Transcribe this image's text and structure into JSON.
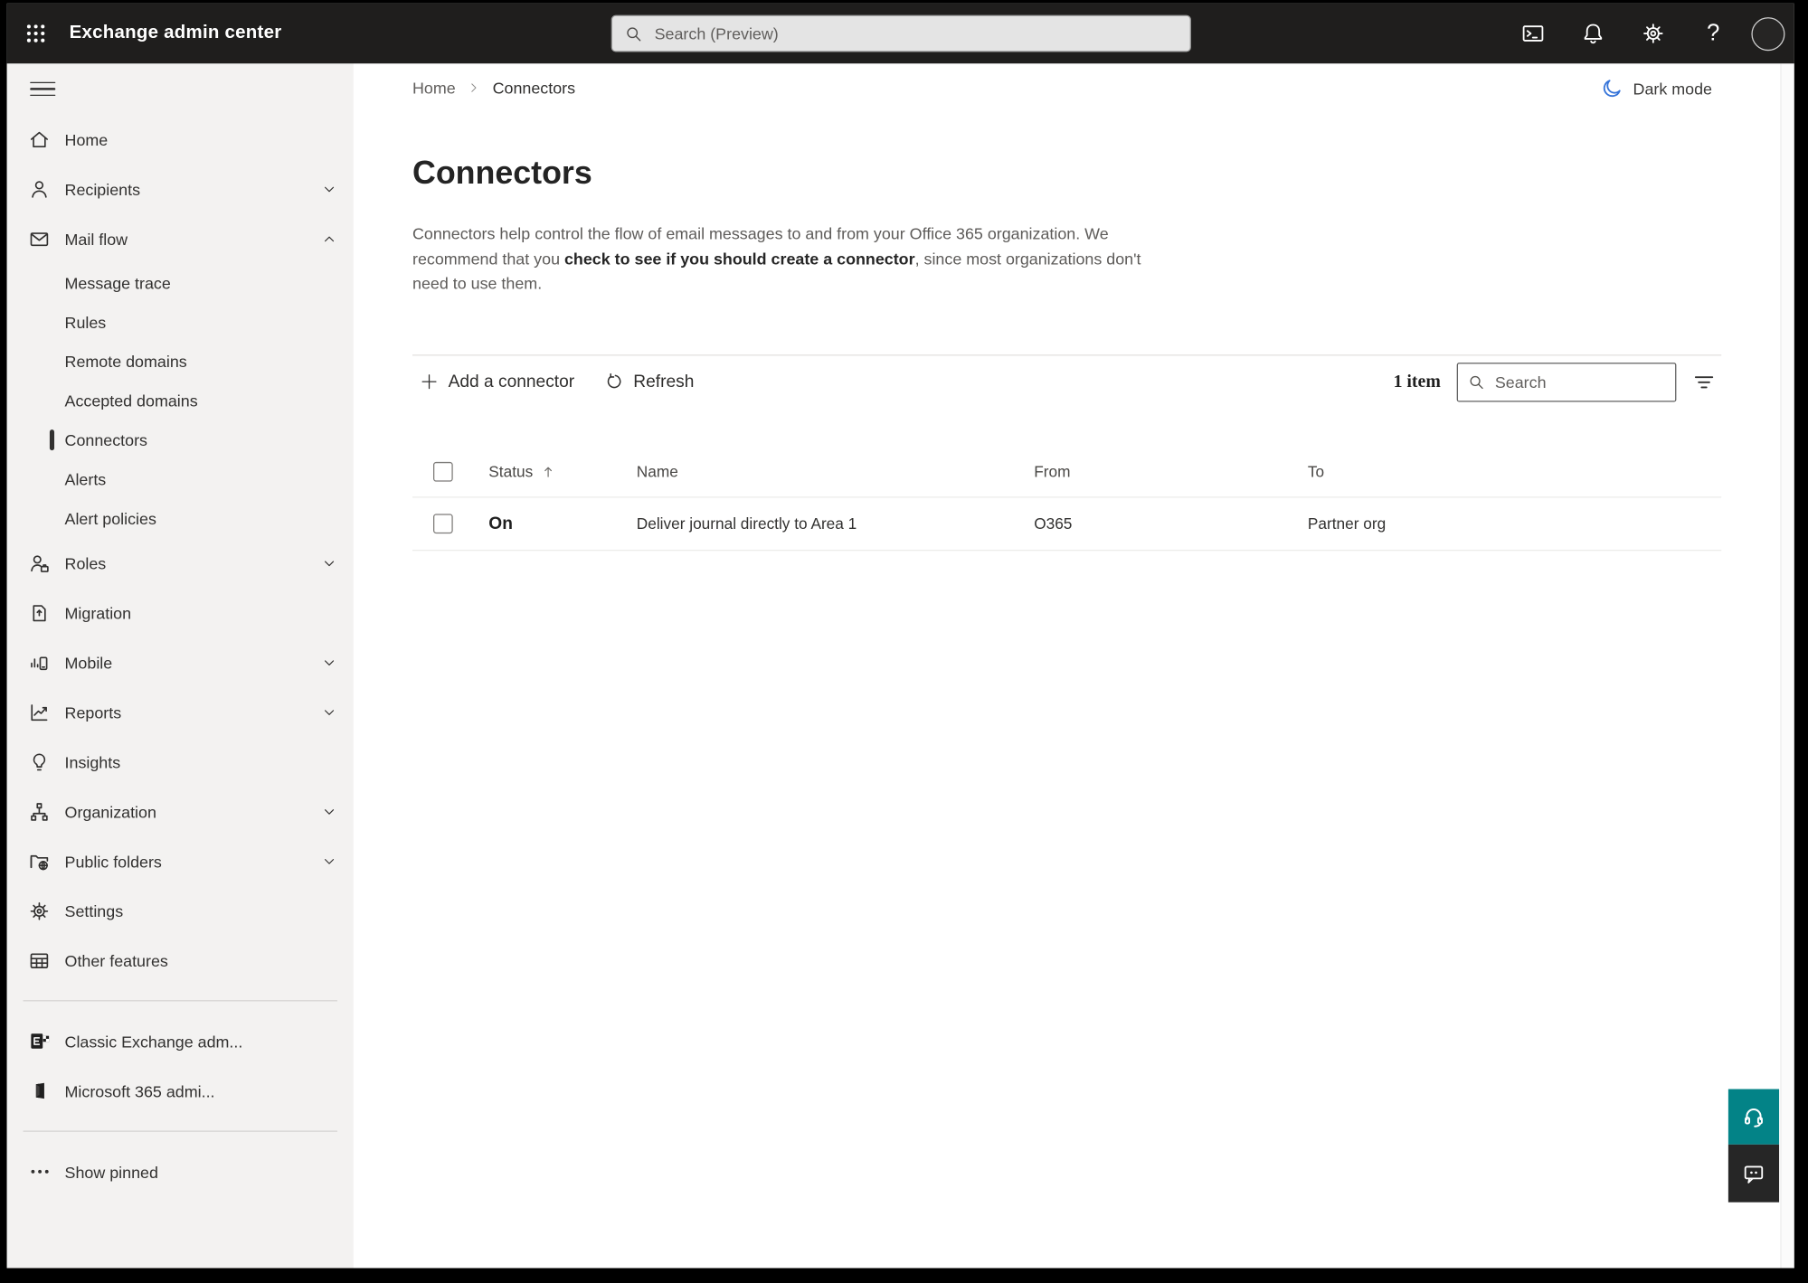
{
  "topbar": {
    "app_title": "Exchange admin center",
    "search_placeholder": "Search (Preview)",
    "icons": [
      "app-launcher",
      "cloud-shell",
      "notifications",
      "settings",
      "help",
      "account"
    ],
    "help_glyph": "?"
  },
  "breadcrumb": {
    "home": "Home",
    "current": "Connectors"
  },
  "dark_mode_label": "Dark mode",
  "page": {
    "title": "Connectors",
    "description_part1": "Connectors help control the flow of email messages to and from your Office 365 organization. We recommend that you ",
    "description_link": "check to see if you should create a connector",
    "description_part2": ", since most organizations don't need to use them."
  },
  "toolbar": {
    "add_label": "Add a connector",
    "refresh_label": "Refresh",
    "item_count": "1 item",
    "search_placeholder": "Search"
  },
  "table": {
    "headers": {
      "status": "Status",
      "name": "Name",
      "from": "From",
      "to": "To"
    },
    "sorted_by": "Status ascending",
    "rows": [
      {
        "status": "On",
        "name": "Deliver journal directly to Area 1",
        "from": "O365",
        "to": "Partner org"
      }
    ]
  },
  "sidebar": {
    "items": [
      {
        "label": "Home",
        "icon": "home-icon"
      },
      {
        "label": "Recipients",
        "icon": "person-icon",
        "chevron": "down"
      },
      {
        "label": "Mail flow",
        "icon": "mail-icon",
        "chevron": "up",
        "expanded": true
      },
      {
        "label": "Message trace",
        "sub": true
      },
      {
        "label": "Rules",
        "sub": true
      },
      {
        "label": "Remote domains",
        "sub": true
      },
      {
        "label": "Accepted domains",
        "sub": true
      },
      {
        "label": "Connectors",
        "sub": true,
        "selected": true
      },
      {
        "label": "Alerts",
        "sub": true
      },
      {
        "label": "Alert policies",
        "sub": true
      },
      {
        "label": "Roles",
        "icon": "roles-icon",
        "chevron": "down"
      },
      {
        "label": "Migration",
        "icon": "migration-icon"
      },
      {
        "label": "Mobile",
        "icon": "mobile-icon",
        "chevron": "down"
      },
      {
        "label": "Reports",
        "icon": "reports-icon",
        "chevron": "down"
      },
      {
        "label": "Insights",
        "icon": "lightbulb-icon"
      },
      {
        "label": "Organization",
        "icon": "org-chart-icon",
        "chevron": "down"
      },
      {
        "label": "Public folders",
        "icon": "folder-globe-icon",
        "chevron": "down"
      },
      {
        "label": "Settings",
        "icon": "gear-icon"
      },
      {
        "label": "Other features",
        "icon": "table-icon"
      },
      {
        "label": "Classic Exchange adm...",
        "icon": "exchange-logo-icon"
      },
      {
        "label": "Microsoft 365 admi...",
        "icon": "m365-logo-icon"
      },
      {
        "label": "Show pinned",
        "icon": "ellipsis-icon"
      }
    ]
  },
  "colors": {
    "topbar_bg": "#1f1e1d",
    "sidebar_bg": "#f3f2f1",
    "accent_moon_blue": "#3674d9",
    "help_teal": "#038387",
    "feedback_dark": "#262626",
    "selected_marker": "#323130"
  }
}
